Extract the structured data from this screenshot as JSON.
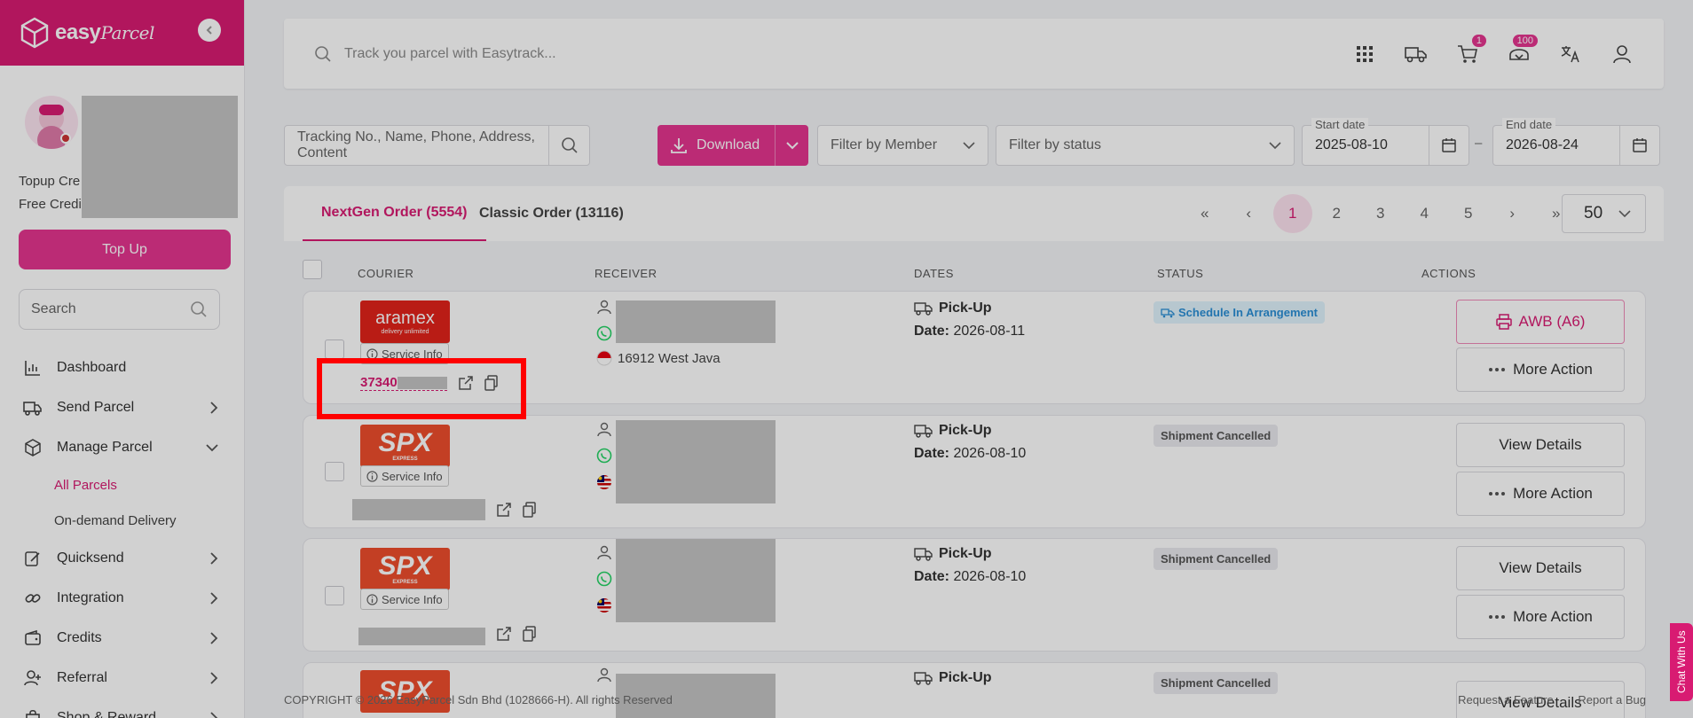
{
  "brand": {
    "name": "easy",
    "name_script": "Parcel"
  },
  "profile": {
    "topup_credit_label": "Topup Cre",
    "free_credit_label": "Free Credi",
    "topup_button": "Top Up"
  },
  "sidebar": {
    "search_placeholder": "Search",
    "items": [
      {
        "label": "Dashboard",
        "icon": "chart-icon",
        "chevron": "none"
      },
      {
        "label": "Send Parcel",
        "icon": "truck-icon",
        "chevron": "right"
      },
      {
        "label": "Manage Parcel",
        "icon": "box-icon",
        "chevron": "down"
      },
      {
        "label": "Quicksend",
        "icon": "edit-box-icon",
        "chevron": "right"
      },
      {
        "label": "Integration",
        "icon": "link-icon",
        "chevron": "right"
      },
      {
        "label": "Credits",
        "icon": "wallet-icon",
        "chevron": "right"
      },
      {
        "label": "Referral",
        "icon": "user-plus-icon",
        "chevron": "right"
      },
      {
        "label": "Shop & Reward",
        "icon": "shop-icon",
        "chevron": "right"
      }
    ],
    "sub_items": [
      {
        "label": "All Parcels",
        "active": true
      },
      {
        "label": "On-demand Delivery",
        "active": false
      }
    ]
  },
  "topbar": {
    "search_placeholder": "Track you parcel with Easytrack...",
    "cart_badge": "1",
    "notif_badge": "100"
  },
  "filters": {
    "search_placeholder": "Tracking No., Name, Phone, Address, Content",
    "download_label": "Download",
    "member_placeholder": "Filter by Member",
    "status_placeholder": "Filter by status",
    "start_label": "Start date",
    "start_value": "2025-08-10",
    "end_label": "End date",
    "end_value": "2026-08-24",
    "dash": "–"
  },
  "tabs": [
    {
      "label": "NextGen Order (5554)",
      "active": true
    },
    {
      "label": "Classic Order (13116)",
      "active": false
    }
  ],
  "pager": {
    "first": "«",
    "prev": "‹",
    "pages": [
      "1",
      "2",
      "3",
      "4",
      "5"
    ],
    "next": "›",
    "last": "»",
    "per_page": "50"
  },
  "table": {
    "headers": {
      "courier": "COURIER",
      "receiver": "RECEIVER",
      "dates": "DATES",
      "status": "STATUS",
      "actions": "ACTIONS"
    }
  },
  "rows": [
    {
      "courier": "aramex",
      "courier_sub": "delivery unlimited",
      "service_info": "Service Info",
      "tracking": "37340",
      "postcode": "16912 West Java",
      "date_type": "Pick-Up",
      "date_label": "Date:",
      "date": "2026-08-11",
      "status": "Schedule In Arrangement",
      "action1": "AWB (A6)",
      "action2": "More Action"
    },
    {
      "courier": "SPX",
      "courier_sub": "EXPRESS",
      "service_info": "Service Info",
      "date_type": "Pick-Up",
      "date_label": "Date:",
      "date": "2026-08-10",
      "status": "Shipment Cancelled",
      "action1": "View Details",
      "action2": "More Action"
    },
    {
      "courier": "SPX",
      "courier_sub": "EXPRESS",
      "service_info": "Service Info",
      "date_type": "Pick-Up",
      "date_label": "Date:",
      "date": "2026-08-10",
      "status": "Shipment Cancelled",
      "action1": "View Details",
      "action2": "More Action"
    },
    {
      "courier": "SPX",
      "date_type": "Pick-Up",
      "status": "Shipment Cancelled",
      "action1": "View Details"
    }
  ],
  "footer": {
    "copyright": "COPYRIGHT © 2026 EasyParcel Sdn Bhd (1028666-H). All rights Reserved",
    "request_feature": "Request a Feature",
    "report_bug": "Report a Bug"
  },
  "chat_label": "Chat With Us",
  "colors": {
    "brand": "#d81b72",
    "accent": "#e5358f",
    "highlight": "#ff0000"
  }
}
